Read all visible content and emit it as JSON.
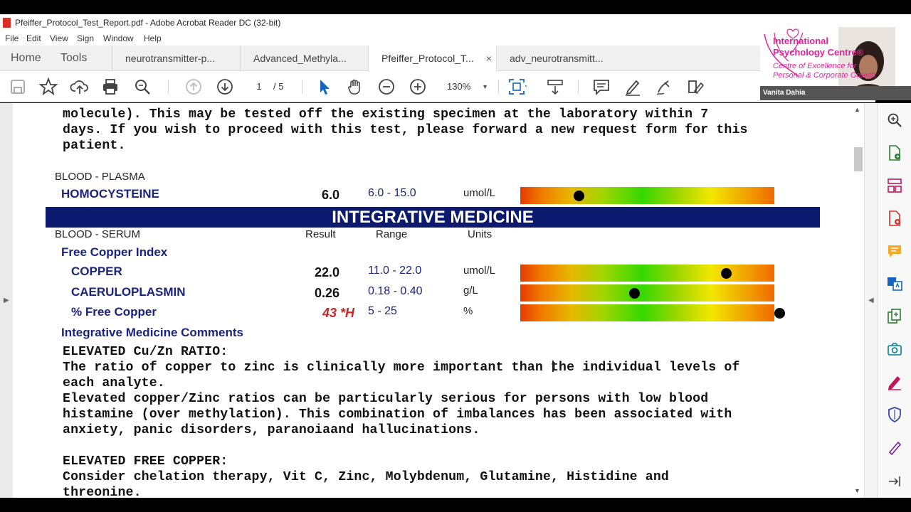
{
  "window": {
    "title": "Pfeiffer_Protocol_Test_Report.pdf - Adobe Acrobat Reader DC (32-bit)"
  },
  "menu": [
    "File",
    "Edit",
    "View",
    "Sign",
    "Window",
    "Help"
  ],
  "tabs": {
    "home": "Home",
    "tools": "Tools",
    "documents": [
      {
        "label": "neurotransmitter-p...",
        "active": false
      },
      {
        "label": "Advanced_Methyla...",
        "active": false
      },
      {
        "label": "Pfeiffer_Protocol_T...",
        "active": true
      },
      {
        "label": "adv_neurotransmitt...",
        "active": false
      }
    ],
    "close_glyph": "×"
  },
  "toolbar": {
    "page_current": "1",
    "page_total": "/ 5",
    "zoom": "130%"
  },
  "document": {
    "intro_lines": [
      "molecule). This may be tested off the existing specimen at the laboratory within 7",
      "days. If you wish to proceed with this test, please forward a new request form for this",
      "patient."
    ],
    "plasma": {
      "section": "BLOOD - PLASMA",
      "name": "HOMOCYSTEINE",
      "result": "6.0",
      "range": "6.0 - 15.0",
      "unit": "umol/L",
      "marker_fraction": 0.23
    },
    "banner": "INTEGRATIVE MEDICINE",
    "serum": {
      "section": "BLOOD - SERUM",
      "col_result": "Result",
      "col_range": "Range",
      "col_units": "Units",
      "group": "Free Copper Index",
      "rows": [
        {
          "name": "COPPER",
          "result": "22.0",
          "flag": "",
          "range": "11.0 - 22.0",
          "unit": "umol/L",
          "marker_fraction": 0.81
        },
        {
          "name": "CAERULOPLASMIN",
          "result": "0.26",
          "flag": "",
          "range": "0.18 - 0.40",
          "unit": "g/L",
          "marker_fraction": 0.45
        },
        {
          "name": "% Free Copper",
          "result": "43",
          "flag": "*H",
          "range": "5 - 25",
          "unit": "%",
          "marker_fraction": 1.02
        }
      ]
    },
    "comments_heading": "Integrative Medicine Comments",
    "comments": [
      "ELEVATED Cu/Zn RATIO:",
      "The ratio of copper to zinc is clinically more important than the individual levels of",
      "each analyte.",
      "Elevated copper/Zinc ratios can be particularly serious for persons with low blood",
      "histamine (over methylation). This combination of imbalances has been associated with",
      "anxiety, panic disorders, paranoiaand hallucinations.",
      "",
      "ELEVATED FREE COPPER:",
      "Consider chelation therapy, Vit C, Zinc, Molybdenum, Glutamine, Histidine and",
      "threonine."
    ]
  },
  "webcam": {
    "org_line1": "International",
    "org_line2": "Psychology Centre®",
    "tagline1": "Centre of Excellence for",
    "tagline2": "Personal & Corporate Growth",
    "presenter": "Vanita Dahia"
  },
  "colors": {
    "banner_bg": "#0b1a6e",
    "label_blue": "#1a237e",
    "flag_red": "#c62828",
    "brand_pink": "#e2239a"
  }
}
